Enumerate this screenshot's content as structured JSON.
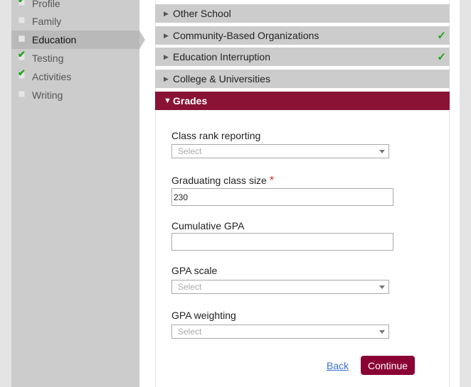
{
  "sidebar": {
    "items": [
      {
        "label": "Profile",
        "checked": true,
        "active": false
      },
      {
        "label": "Family",
        "checked": false,
        "active": false
      },
      {
        "label": "Education",
        "checked": false,
        "active": true
      },
      {
        "label": "Testing",
        "checked": true,
        "active": false
      },
      {
        "label": "Activities",
        "checked": true,
        "active": false
      },
      {
        "label": "Writing",
        "checked": false,
        "active": false
      }
    ],
    "check_glyph": "✔"
  },
  "accordion": {
    "sections": [
      {
        "label": "Other School",
        "complete": false,
        "expanded": false
      },
      {
        "label": "Community-Based Organizations",
        "complete": true,
        "expanded": false
      },
      {
        "label": "Education Interruption",
        "complete": true,
        "expanded": false
      },
      {
        "label": "College & Universities",
        "complete": false,
        "expanded": false
      },
      {
        "label": "Grades",
        "complete": false,
        "expanded": true
      }
    ],
    "collapsed_glyph": "▶",
    "expanded_glyph": "▼",
    "complete_glyph": "✓"
  },
  "form": {
    "class_rank": {
      "label": "Class rank reporting",
      "value": "Select"
    },
    "class_size": {
      "label": "Graduating class size",
      "required_mark": "*",
      "value": "230"
    },
    "cumulative_gpa": {
      "label": "Cumulative GPA",
      "value": ""
    },
    "gpa_scale": {
      "label": "GPA scale",
      "value": "Select"
    },
    "gpa_weighting": {
      "label": "GPA weighting",
      "value": "Select"
    }
  },
  "actions": {
    "back_label": "Back",
    "continue_label": "Continue"
  },
  "colors": {
    "accent": "#8a1235",
    "check": "#1aa51a",
    "link": "#3a6fd8"
  }
}
